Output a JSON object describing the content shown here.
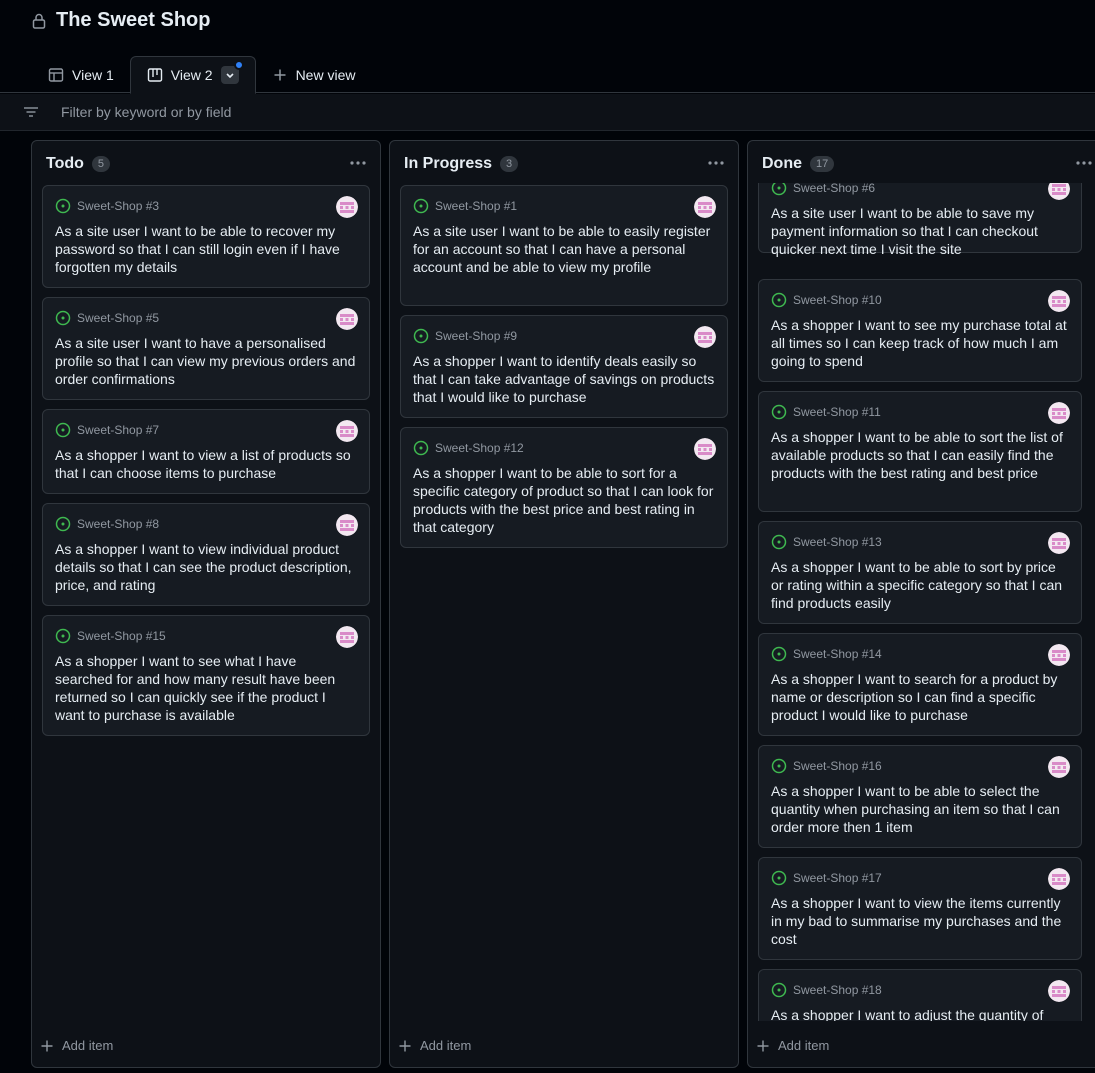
{
  "header": {
    "title": "The Sweet Shop"
  },
  "tabs": [
    {
      "label": "View 1"
    },
    {
      "label": "View 2"
    },
    {
      "label": "New view"
    }
  ],
  "filter": {
    "placeholder": "Filter by keyword or by field"
  },
  "columns": [
    {
      "title": "Todo",
      "count": "5",
      "add_label": "Add item",
      "cards": [
        {
          "ref": "Sweet-Shop #3",
          "text": "As a site user I want to be able to recover my password so that I can still login even if I have forgotten my details"
        },
        {
          "ref": "Sweet-Shop #5",
          "text": "As a site user I want to have a personalised profile so that I can view my previous orders and order confirmations"
        },
        {
          "ref": "Sweet-Shop #7",
          "text": "As a shopper I want to view a list of products so that I can choose items to purchase"
        },
        {
          "ref": "Sweet-Shop #8",
          "text": "As a shopper I want to view individual product details so that I can see the product description, price, and rating"
        },
        {
          "ref": "Sweet-Shop #15",
          "text": "As a shopper I want to see what I have searched for and how many result have been returned so I can quickly see if the product I want to purchase is available"
        }
      ]
    },
    {
      "title": "In Progress",
      "count": "3",
      "add_label": "Add item",
      "cards": [
        {
          "ref": "Sweet-Shop #1",
          "text": "As a site user I want to be able to easily register for an account so that I can have a personal account and be able to view my profile"
        },
        {
          "ref": "Sweet-Shop #9",
          "text": "As a shopper I want to identify deals easily so that I can take advantage of savings on products that I would like to purchase"
        },
        {
          "ref": "Sweet-Shop #12",
          "text": "As a shopper I want to be able to sort for a specific category of product so that I can look for products with the best price and best rating in that category"
        }
      ]
    },
    {
      "title": "Done",
      "count": "17",
      "add_label": "Add item",
      "cards": [
        {
          "ref": "Sweet-Shop #6",
          "text": "As a site user I want to be able to save my payment information so that I can checkout quicker next time I visit the site"
        },
        {
          "ref": "Sweet-Shop #10",
          "text": "As a shopper I want to see my purchase total at all times so I can keep track of how much I am going to spend"
        },
        {
          "ref": "Sweet-Shop #11",
          "text": "As a shopper I want to be able to sort the list of available products so that I can easily find the products with the best rating and best price"
        },
        {
          "ref": "Sweet-Shop #13",
          "text": "As a shopper I want to be able to sort by price or rating within a specific category so that I can find products easily"
        },
        {
          "ref": "Sweet-Shop #14",
          "text": "As a shopper I want to search for a product by name or description so I can find a specific product I would like to purchase"
        },
        {
          "ref": "Sweet-Shop #16",
          "text": "As a shopper I want to be able to select the quantity when purchasing an item so that I can order more then 1 item"
        },
        {
          "ref": "Sweet-Shop #17",
          "text": "As a shopper I want to view the items currently in my bad to summarise my purchases and the cost"
        },
        {
          "ref": "Sweet-Shop #18",
          "text": "As a shopper I want to adjust the quantity of"
        }
      ]
    }
  ],
  "colors": {
    "issue_open": "#3fb950",
    "accent_dot": "#2f81f7",
    "avatar_pink": "#e6a3d8"
  }
}
